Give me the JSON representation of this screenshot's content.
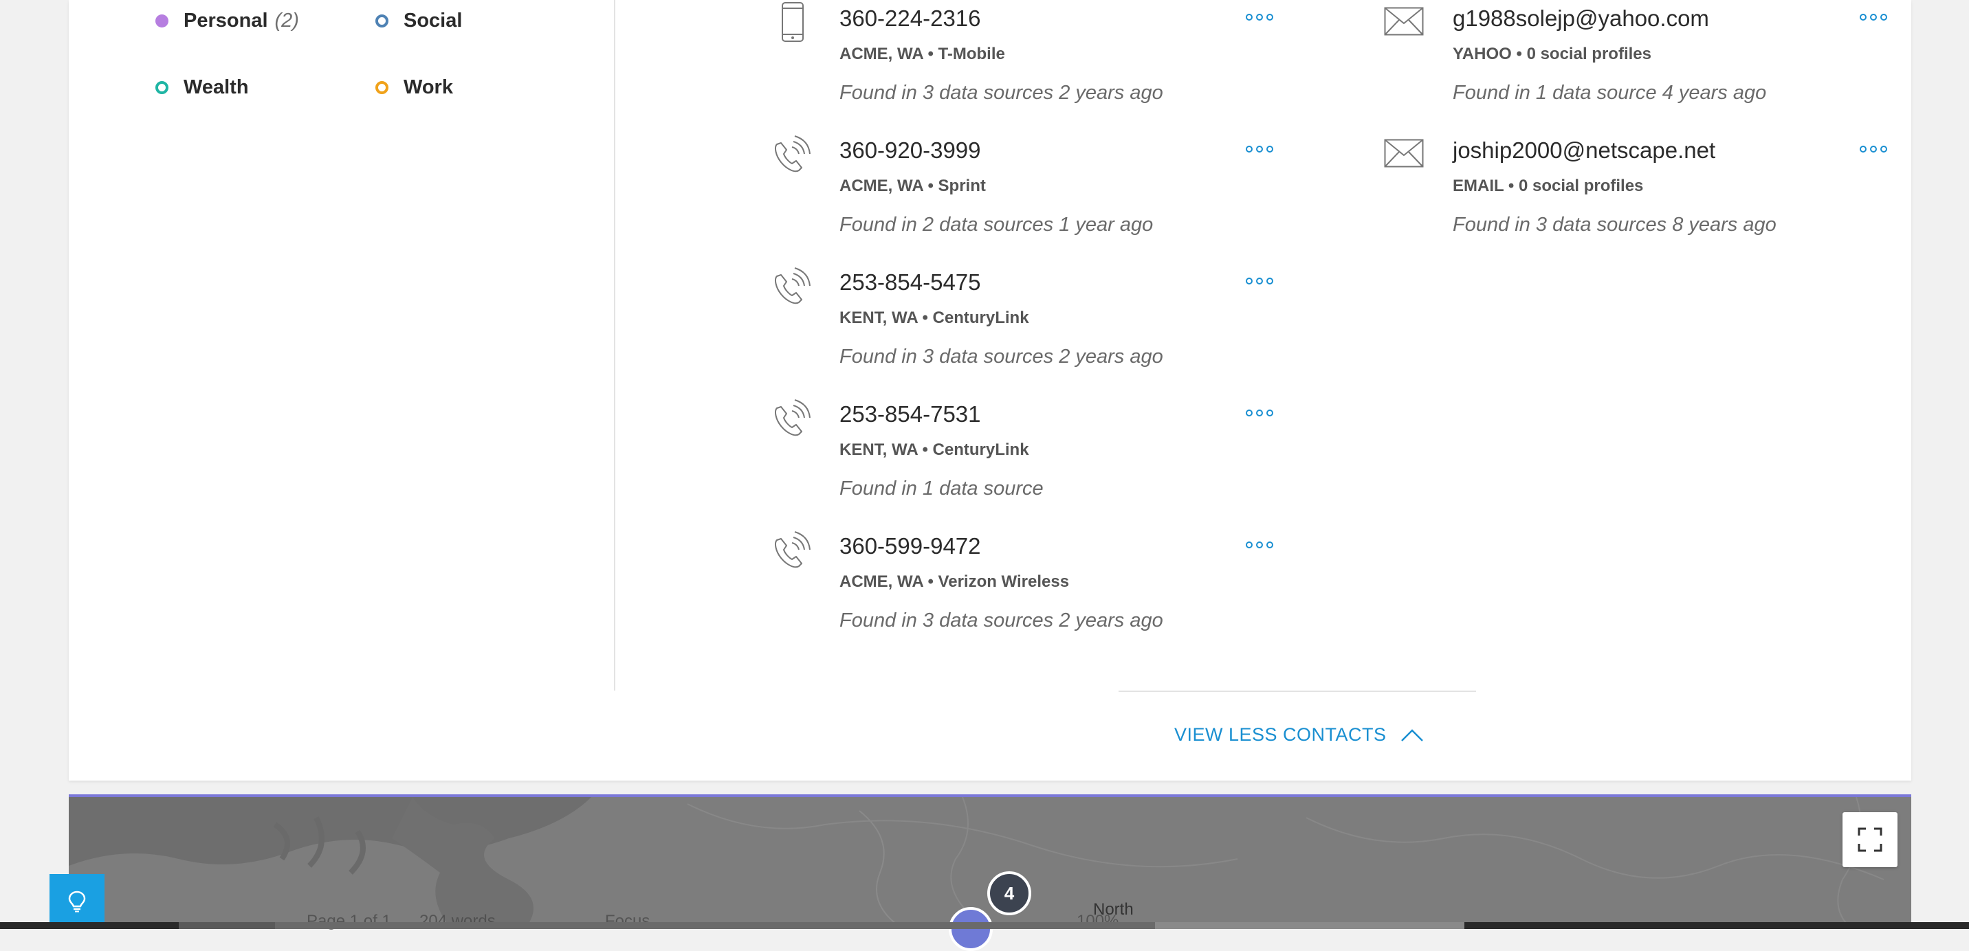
{
  "legend": {
    "personal": {
      "label": "Personal",
      "count": "(2)",
      "color": "#b67ee0"
    },
    "social": {
      "label": "Social",
      "color": "#4e82b4"
    },
    "wealth": {
      "label": "Wealth",
      "color": "#1fb5a4"
    },
    "work": {
      "label": "Work",
      "color": "#f0a21a"
    }
  },
  "phones": [
    {
      "icon": "mobile-phone-icon",
      "number": "360-224-2316",
      "location": "ACME, WA",
      "carrier": "T-Mobile",
      "found": "Found in 3 data sources 2 years ago"
    },
    {
      "icon": "landline-phone-icon",
      "number": "360-920-3999",
      "location": "ACME, WA",
      "carrier": "Sprint",
      "found": "Found in 2 data sources 1 year ago"
    },
    {
      "icon": "landline-phone-icon",
      "number": "253-854-5475",
      "location": "KENT, WA",
      "carrier": "CenturyLink",
      "found": "Found in 3 data sources 2 years ago"
    },
    {
      "icon": "landline-phone-icon",
      "number": "253-854-7531",
      "location": "KENT, WA",
      "carrier": "CenturyLink",
      "found": "Found in 1 data source"
    },
    {
      "icon": "landline-phone-icon",
      "number": "360-599-9472",
      "location": "ACME, WA",
      "carrier": "Verizon Wireless",
      "found": "Found in 3 data sources 2 years ago"
    }
  ],
  "emails": [
    {
      "icon": "envelope-icon",
      "address": "g1988solejp@yahoo.com",
      "provider": "YAHOO",
      "profiles": "0 social profiles",
      "found": "Found in 1 data source 4 years ago"
    },
    {
      "icon": "envelope-icon",
      "address": "joship2000@netscape.net",
      "provider": "EMAIL",
      "profiles": "0 social profiles",
      "found": "Found in 3 data sources 8 years ago"
    }
  ],
  "separator": "•",
  "view_less": "VIEW LESS CONTACTS",
  "map": {
    "cluster_count": "4",
    "compass_label": "North",
    "fullscreen_icon": "expand-icon"
  },
  "help_icon": "lightbulb-icon",
  "accent_color": "#1a8fd1",
  "background_ghost": {
    "page": "Page 1 of 1",
    "words": "204 words",
    "focus": "Focus",
    "zoom": "100%"
  }
}
